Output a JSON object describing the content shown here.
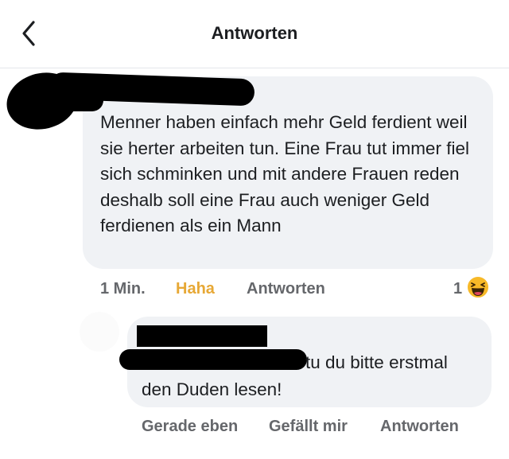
{
  "header": {
    "title": "Antworten"
  },
  "comment": {
    "text": "Menner haben einfach mehr Geld ferdient weil sie herter arbeiten tun. Eine Frau tut immer fiel sich schminken und mit andere Frauen reden deshalb soll eine Frau auch weniger Geld ferdienen als ein Mann",
    "time": "1 Min.",
    "reaction_label": "Haha",
    "reply_label": "Antworten",
    "reaction_count": "1",
    "reaction_icon": "haha-emoji-icon",
    "reaction_color": "#e7a835"
  },
  "reply": {
    "text_line1": "tu du bitte erstmal",
    "text_line2": "den Duden lesen!",
    "time": "Gerade eben",
    "like_label": "Gefällt mir",
    "reply_label": "Antworten"
  }
}
